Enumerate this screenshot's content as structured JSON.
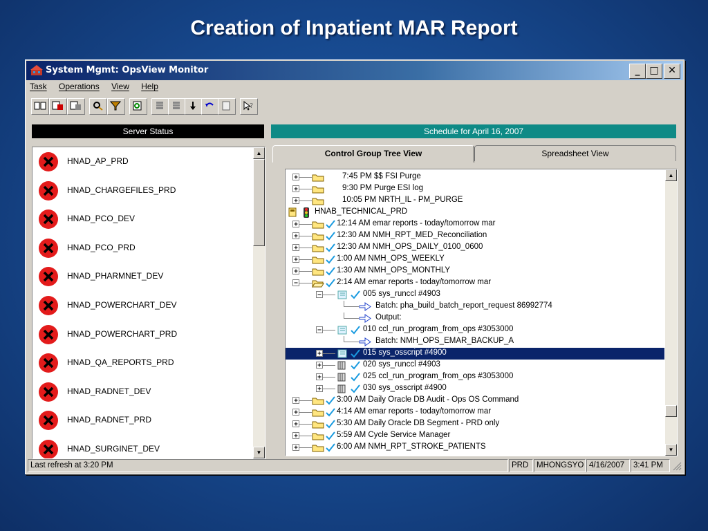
{
  "slide_title": "Creation of Inpatient MAR Report",
  "window": {
    "title": "System Mgmt: OpsView Monitor",
    "controls": {
      "minimize": "_",
      "maximize": "□",
      "close": "✕"
    }
  },
  "menu": [
    "Task",
    "Operations",
    "View",
    "Help"
  ],
  "headers": {
    "server_status": "Server Status",
    "schedule": "Schedule for April 16, 2007"
  },
  "servers": [
    "HNAD_AP_PRD",
    "HNAD_CHARGEFILES_PRD",
    "HNAD_PCO_DEV",
    "HNAD_PCO_PRD",
    "HNAD_PHARMNET_DEV",
    "HNAD_POWERCHART_DEV",
    "HNAD_POWERCHART_PRD",
    "HNAD_QA_REPORTS_PRD",
    "HNAD_RADNET_DEV",
    "HNAD_RADNET_PRD",
    "HNAD_SURGINET_DEV"
  ],
  "tabs": {
    "control_group": "Control Group Tree View",
    "spreadsheet": "Spreadsheet View"
  },
  "tree": [
    {
      "text": "7:45 PM  $$ FSI Purge",
      "type": "folder",
      "level": 1,
      "check": false
    },
    {
      "text": "9:30 PM  Purge ESI log",
      "type": "folder",
      "level": 1,
      "check": false
    },
    {
      "text": "10:05 PM  NRTH_IL - PM_PURGE",
      "type": "folder",
      "level": 1,
      "check": false
    },
    {
      "text": "HNAB_TECHNICAL_PRD",
      "type": "root",
      "level": 0,
      "check": false
    },
    {
      "text": "12:14 AM  emar reports - today/tomorrow mar",
      "type": "folder",
      "level": 1,
      "check": true
    },
    {
      "text": "12:30 AM  NMH_RPT_MED_Reconciliation",
      "type": "folder",
      "level": 1,
      "check": true
    },
    {
      "text": "12:30 AM  NMH_OPS_DAILY_0100_0600",
      "type": "folder",
      "level": 1,
      "check": true
    },
    {
      "text": "1:00 AM  NMH_OPS_WEEKLY",
      "type": "folder",
      "level": 1,
      "check": true
    },
    {
      "text": "1:30 AM  NMH_OPS_MONTHLY",
      "type": "folder",
      "level": 1,
      "check": true
    },
    {
      "text": "2:14 AM  emar reports - today/tomorrow mar",
      "type": "openfolder",
      "level": 1,
      "check": true
    },
    {
      "text": "005  sys_runccl  #4903",
      "type": "job",
      "level": 2,
      "check": true
    },
    {
      "text": "Batch:  pha_build_batch_report_request 86992774",
      "type": "arrow",
      "level": 3,
      "check": false
    },
    {
      "text": "Output:",
      "type": "arrow",
      "level": 3,
      "check": false
    },
    {
      "text": "010  ccl_run_program_from_ops  #3053000",
      "type": "job",
      "level": 2,
      "check": true
    },
    {
      "text": "Batch:  NMH_OPS_EMAR_BACKUP_A",
      "type": "arrow",
      "level": 3,
      "check": false
    },
    {
      "text": "015  sys_osscript  #4900",
      "type": "job",
      "level": 2,
      "check": true,
      "selected": true
    },
    {
      "text": "020  sys_runccl  #4903",
      "type": "job2",
      "level": 2,
      "check": true
    },
    {
      "text": "025  ccl_run_program_from_ops  #3053000",
      "type": "job2",
      "level": 2,
      "check": true
    },
    {
      "text": "030  sys_osscript  #4900",
      "type": "job2",
      "level": 2,
      "check": true
    },
    {
      "text": "3:00 AM  Daily Oracle DB Audit - Ops OS Command",
      "type": "folder",
      "level": 1,
      "check": true
    },
    {
      "text": "4:14 AM  emar reports - today/tomorrow mar",
      "type": "folder",
      "level": 1,
      "check": true
    },
    {
      "text": "5:30 AM  Daily Oracle DB Segment - PRD only",
      "type": "folder",
      "level": 1,
      "check": true
    },
    {
      "text": "5:59 AM  Cycle Service Manager",
      "type": "folder",
      "level": 1,
      "check": true
    },
    {
      "text": "6:00 AM  NMH_RPT_STROKE_PATIENTS",
      "type": "folder",
      "level": 1,
      "check": true
    }
  ],
  "statusbar": {
    "refresh": "Last refresh at 3:20 PM",
    "env": "PRD",
    "user": "MHONGSYO",
    "date": "4/16/2007",
    "time": "3:41 PM"
  },
  "colors": {
    "error": "#e31b1b",
    "teal": "#0e8a86",
    "selection": "#0a246a",
    "check": "#1a9be0"
  }
}
